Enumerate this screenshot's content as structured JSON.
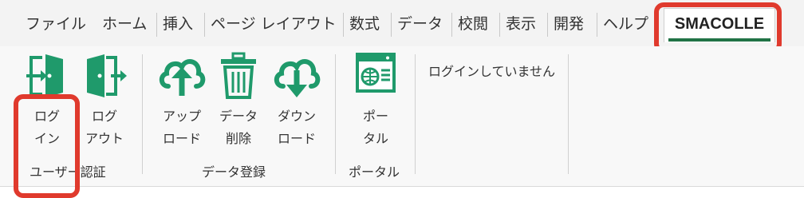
{
  "tabs": [
    {
      "id": "file",
      "label": "ファイル"
    },
    {
      "id": "home",
      "label": "ホーム"
    },
    {
      "id": "insert",
      "label": "挿入"
    },
    {
      "id": "page_layout",
      "label": "ページ レイアウト"
    },
    {
      "id": "formulas",
      "label": "数式"
    },
    {
      "id": "data",
      "label": "データ"
    },
    {
      "id": "review",
      "label": "校閲"
    },
    {
      "id": "view",
      "label": "表示"
    },
    {
      "id": "developer",
      "label": "開発"
    },
    {
      "id": "help",
      "label": "ヘルプ"
    },
    {
      "id": "smacolle",
      "label": "SMACOLLE",
      "active": true
    }
  ],
  "groups": {
    "user_auth": {
      "label": "ユーザー認証",
      "login": {
        "line1": "ログ",
        "line2": "イン",
        "icon": "login-door-icon"
      },
      "logout": {
        "line1": "ログ",
        "line2": "アウト",
        "icon": "logout-door-icon"
      }
    },
    "data_register": {
      "label": "データ登録",
      "upload": {
        "line1": "アップ",
        "line2": "ロード",
        "icon": "cloud-upload-icon"
      },
      "delete": {
        "line1": "データ",
        "line2": "削除",
        "icon": "trash-icon"
      },
      "download": {
        "line1": "ダウン",
        "line2": "ロード",
        "icon": "cloud-download-icon"
      }
    },
    "portal": {
      "label": "ポータル",
      "portal": {
        "line1": "ポー",
        "line2": "タル",
        "icon": "web-portal-icon"
      }
    }
  },
  "status_text": "ログインしていません",
  "colors": {
    "accent": "#217346",
    "icon_green": "#1f9a6b",
    "highlight": "#e03a2d"
  }
}
